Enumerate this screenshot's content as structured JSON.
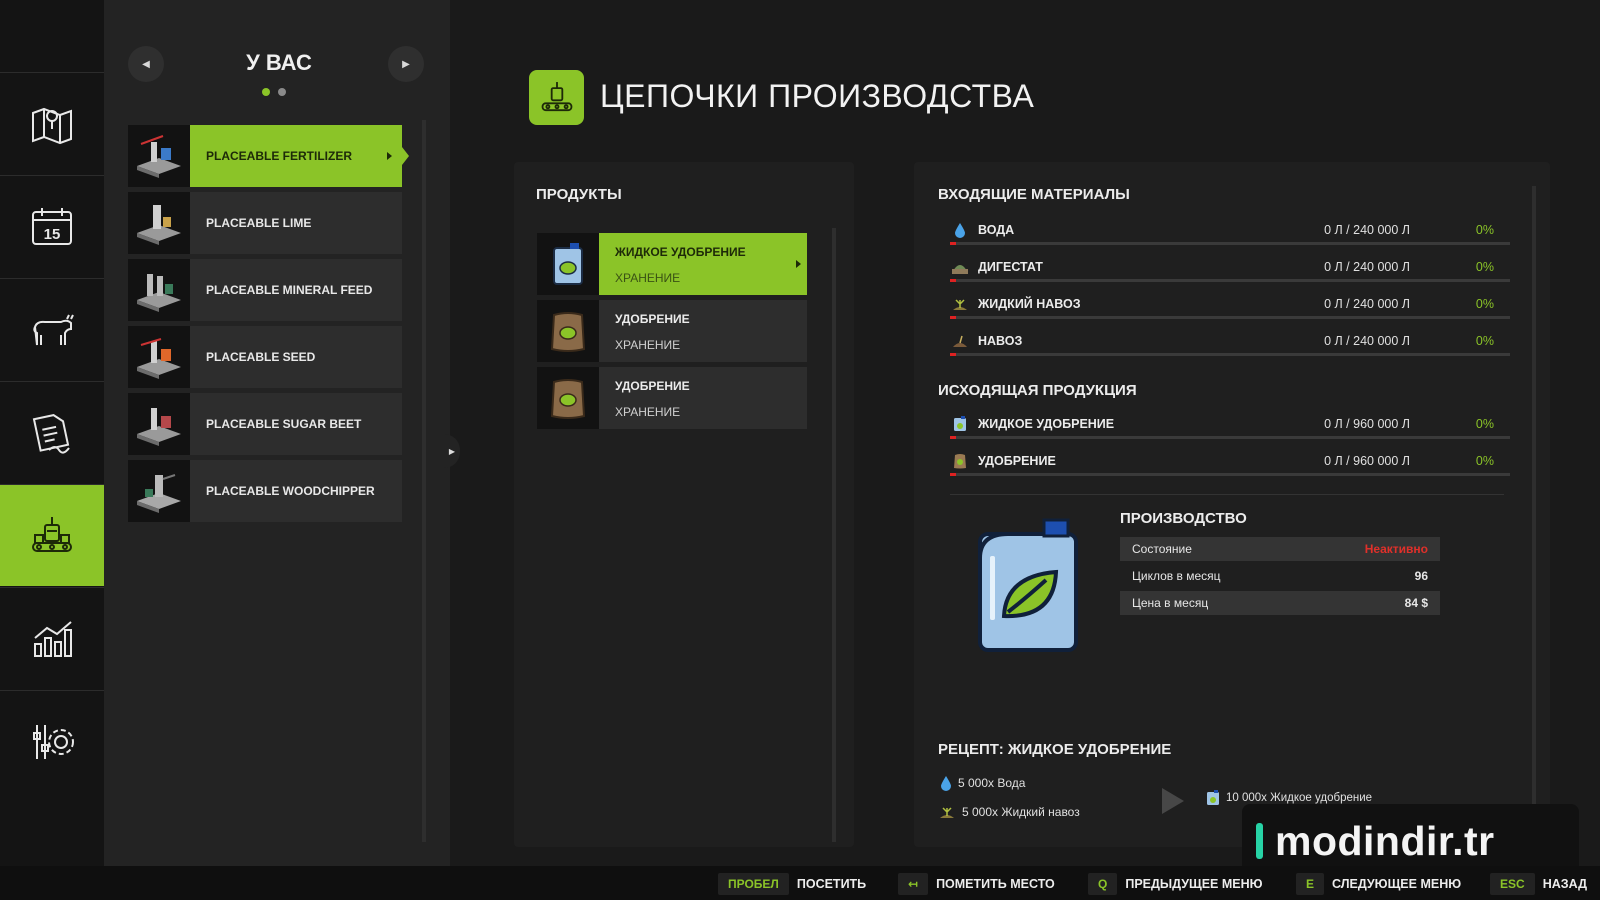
{
  "nav": {
    "items": [
      {
        "icon": "map-icon"
      },
      {
        "icon": "calendar-icon",
        "text": "15"
      },
      {
        "icon": "animals-icon"
      },
      {
        "icon": "contracts-icon"
      },
      {
        "icon": "production-icon",
        "active": true
      },
      {
        "icon": "statistics-icon"
      },
      {
        "icon": "settings-icon"
      }
    ]
  },
  "list_panel": {
    "title": "У ВАС",
    "page_dots": 2,
    "active_dot": 0,
    "items": [
      {
        "label": "PLACEABLE FERTILIZER",
        "active": true
      },
      {
        "label": "PLACEABLE LIME"
      },
      {
        "label": "PLACEABLE MINERAL FEED"
      },
      {
        "label": "PLACEABLE SEED"
      },
      {
        "label": "PLACEABLE SUGAR BEET"
      },
      {
        "label": "PLACEABLE WOODCHIPPER"
      }
    ]
  },
  "header": {
    "title": "ЦЕПОЧКИ ПРОИЗВОДСТВА"
  },
  "products": {
    "heading": "ПРОДУКТЫ",
    "items": [
      {
        "name": "ЖИДКОЕ УДОБРЕНИЕ",
        "sub": "ХРАНЕНИЕ",
        "active": true
      },
      {
        "name": "УДОБРЕНИЕ",
        "sub": "ХРАНЕНИЕ"
      },
      {
        "name": "УДОБРЕНИЕ",
        "sub": "ХРАНЕНИЕ"
      }
    ]
  },
  "inputs": {
    "heading": "ВХОДЯЩИЕ МАТЕРИАЛЫ",
    "rows": [
      {
        "name": "ВОДА",
        "amount": "0 Л / 240 000 Л",
        "pct": "0%"
      },
      {
        "name": "ДИГЕСТАТ",
        "amount": "0 Л / 240 000 Л",
        "pct": "0%"
      },
      {
        "name": "ЖИДКИЙ НАВОЗ",
        "amount": "0 Л / 240 000 Л",
        "pct": "0%"
      },
      {
        "name": "НАВОЗ",
        "amount": "0 Л / 240 000 Л",
        "pct": "0%"
      }
    ]
  },
  "outputs": {
    "heading": "ИСХОДЯЩАЯ ПРОДУКЦИЯ",
    "rows": [
      {
        "name": "ЖИДКОЕ УДОБРЕНИЕ",
        "amount": "0 Л / 960 000 Л",
        "pct": "0%"
      },
      {
        "name": "УДОБРЕНИЕ",
        "amount": "0 Л / 960 000 Л",
        "pct": "0%"
      }
    ]
  },
  "production": {
    "heading": "ПРОИЗВОДСТВО",
    "rows": [
      {
        "label": "Состояние",
        "value": "Неактивно"
      },
      {
        "label": "Циклов в месяц",
        "value": "96"
      },
      {
        "label": "Цена в месяц",
        "value": "84 $"
      }
    ]
  },
  "recipe": {
    "heading": "РЕЦЕПТ: ЖИДКОЕ УДОБРЕНИЕ",
    "inputs": [
      "5 000x Вода",
      "5 000x Жидкий навоз"
    ],
    "output": "10 000x Жидкое удобрение"
  },
  "watermark": {
    "text": "modindir.tr"
  },
  "bottom_bar": {
    "hints": [
      {
        "key": "ПРОБЕЛ",
        "label": "ПОСЕТИТЬ"
      },
      {
        "key": "↤",
        "label": "ПОМЕТИТЬ МЕСТО"
      },
      {
        "key": "Q",
        "label": "ПРЕДЫДУЩЕЕ МЕНЮ"
      },
      {
        "key": "E",
        "label": "СЛЕДУЮЩЕЕ МЕНЮ"
      },
      {
        "key": "ESC",
        "label": "НАЗАД"
      }
    ]
  },
  "colors": {
    "accent": "#8bc428",
    "inactive_status": "#e0302a",
    "fill_level": "#dd2222"
  }
}
